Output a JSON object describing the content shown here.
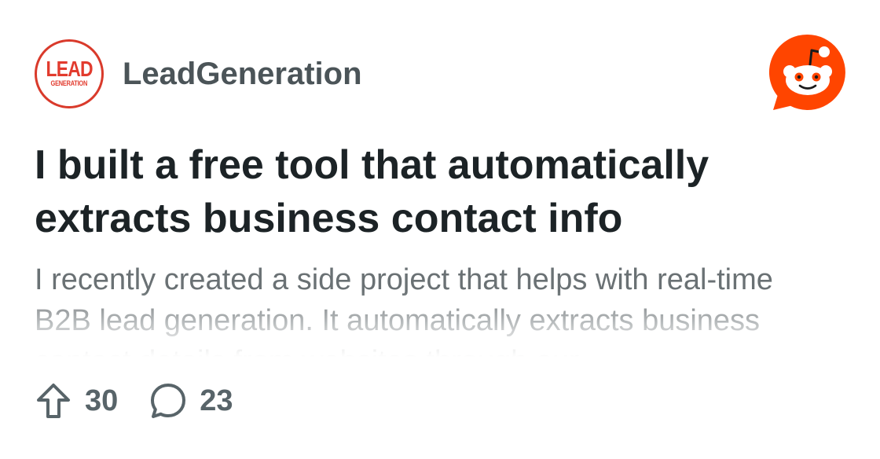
{
  "subreddit": {
    "name": "LeadGeneration",
    "logo_text_big": "LEAD",
    "logo_text_small": "GENERATION"
  },
  "post": {
    "title": "I built a free tool that automatically extracts business contact info",
    "body": "I recently created a side project that helps with real-time B2B lead generation. It automatically extracts business contact details from websites through our"
  },
  "stats": {
    "upvotes": "30",
    "comments": "23"
  },
  "icons": {
    "brand": "reddit-icon",
    "upvote": "upvote-arrow-icon",
    "comment": "comment-bubble-icon"
  },
  "colors": {
    "brand": "#ff4500",
    "logo_red": "#e23b2e",
    "title": "#1c2326",
    "body": "#6a7174",
    "meta": "#586469"
  }
}
